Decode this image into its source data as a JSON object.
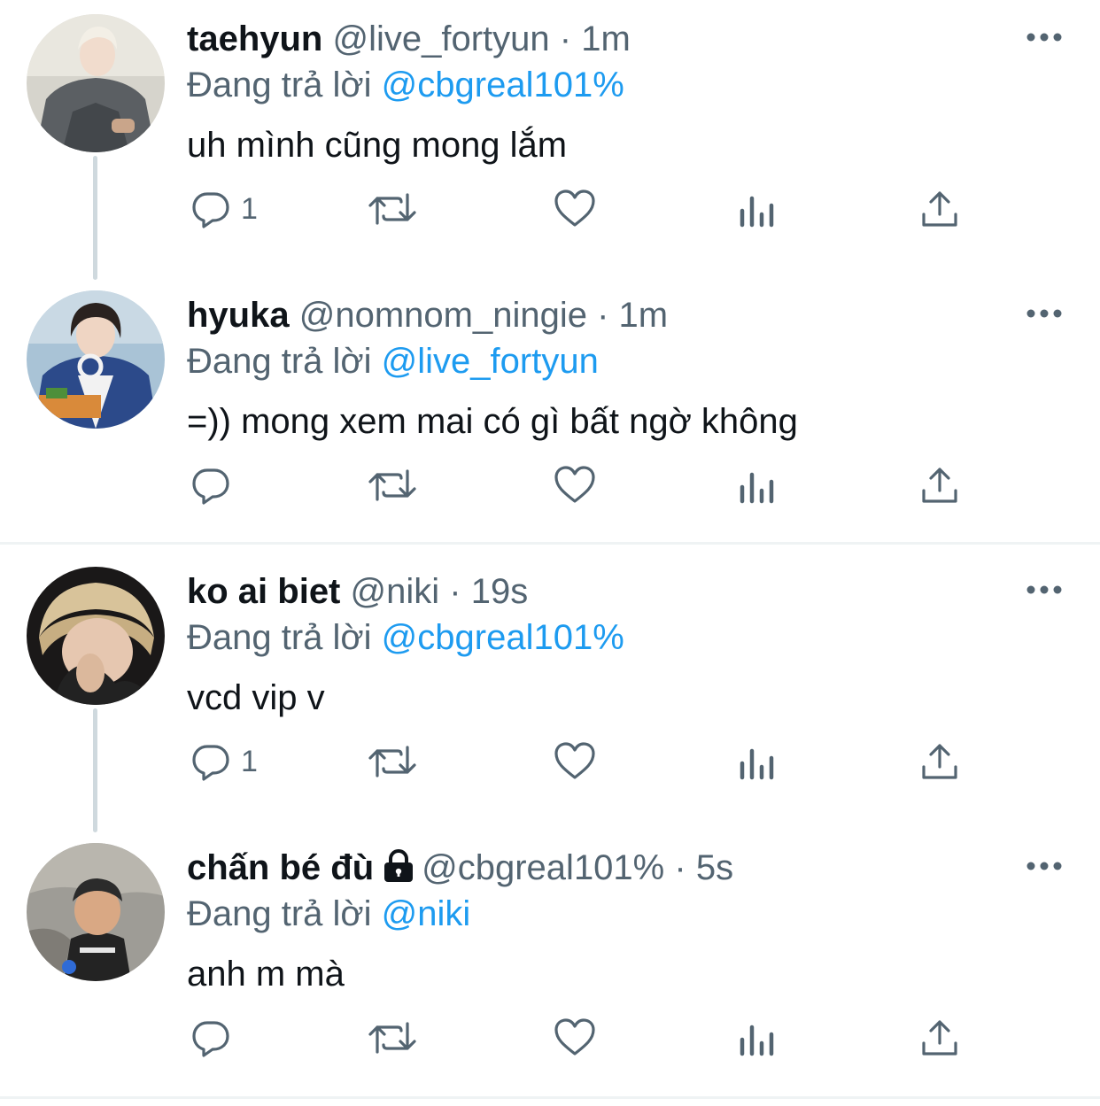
{
  "tweets": [
    {
      "name": "taehyun",
      "handle": "@live_fortyun",
      "dot": "·",
      "time": "1m",
      "reply_prefix": "Đang trả lời",
      "reply_to": "@cbgreal101%",
      "text": "uh mình cũng mong lắm",
      "reply_count": "1",
      "locked": false,
      "thread_line": true
    },
    {
      "name": "hyuka",
      "handle": "@nomnom_ningie",
      "dot": "·",
      "time": "1m",
      "reply_prefix": "Đang trả lời",
      "reply_to": "@live_fortyun",
      "text": "=)) mong xem mai có gì bất ngờ không",
      "reply_count": "",
      "locked": false,
      "thread_line": false
    },
    {
      "name": "ko ai biet",
      "handle": "@niki",
      "dot": "·",
      "time": "19s",
      "reply_prefix": "Đang trả lời",
      "reply_to": "@cbgreal101%",
      "text": "vcd vip v",
      "reply_count": "1",
      "locked": false,
      "thread_line": true
    },
    {
      "name": "chấn bé đù",
      "handle": "@cbgreal101%",
      "dot": "·",
      "time": "5s",
      "reply_prefix": "Đang trả lời",
      "reply_to": "@niki",
      "text": "anh m mà",
      "reply_count": "",
      "locked": true,
      "thread_line": false
    }
  ],
  "icons": {
    "reply": "reply-icon",
    "retweet": "retweet-icon",
    "like": "like-icon",
    "views": "views-icon",
    "share": "share-icon",
    "more": "more-icon",
    "lock": "lock-icon"
  },
  "colors": {
    "text": "#0f1419",
    "secondary": "#536471",
    "link": "#1d9bf0",
    "divider": "#eff3f4",
    "thread_line": "#cfd9de"
  }
}
